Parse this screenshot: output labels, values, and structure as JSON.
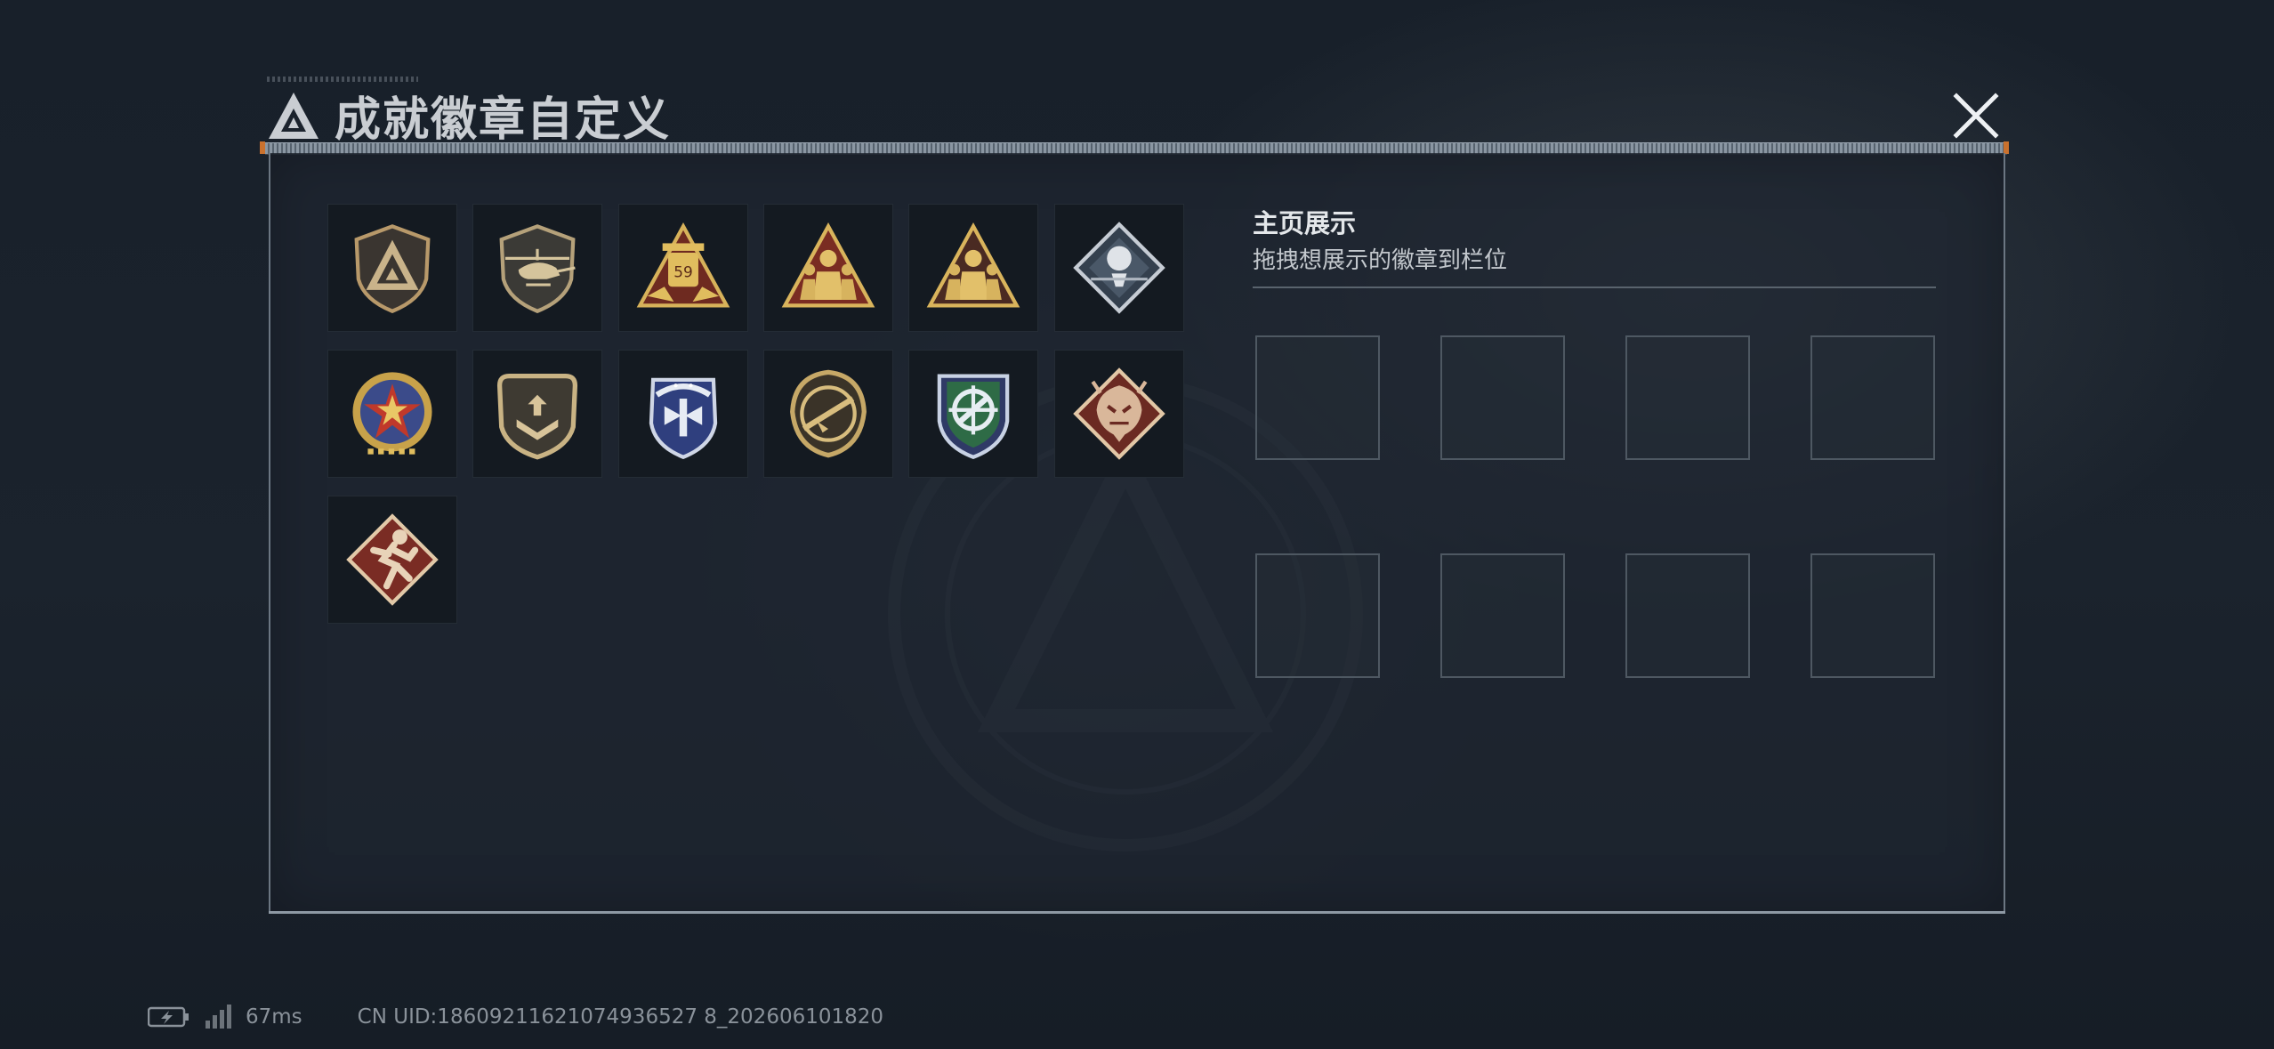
{
  "window": {
    "title": "成就徽章自定义",
    "close_label": "close"
  },
  "badges": [
    {
      "name": "emblem-shield-badge",
      "shape": "shield",
      "theme": "bronze"
    },
    {
      "name": "helicopter-badge",
      "shape": "shield",
      "theme": "bronze"
    },
    {
      "name": "gold-59-badge",
      "shape": "triangle",
      "theme": "gold",
      "label": "59"
    },
    {
      "name": "team-red-triangle-badge",
      "shape": "triangle",
      "theme": "gold"
    },
    {
      "name": "team-dark-triangle-badge",
      "shape": "triangle",
      "theme": "gold"
    },
    {
      "name": "rose-diamond-badge",
      "shape": "diamond",
      "theme": "silver"
    },
    {
      "name": "star-medal-badge",
      "shape": "round",
      "theme": "gold-red"
    },
    {
      "name": "chevron-shield-badge",
      "shape": "shield",
      "theme": "bronze"
    },
    {
      "name": "wings-blue-shield-badge",
      "shape": "shield",
      "theme": "blue"
    },
    {
      "name": "rifle-round-badge",
      "shape": "round",
      "theme": "bronze"
    },
    {
      "name": "crosshair-green-shield-badge",
      "shape": "shield",
      "theme": "green"
    },
    {
      "name": "dragon-diamond-badge",
      "shape": "diamond",
      "theme": "red"
    },
    {
      "name": "runner-diamond-badge",
      "shape": "diamond",
      "theme": "red"
    }
  ],
  "showcase": {
    "title": "主页展示",
    "subtitle": "拖拽想展示的徽章到栏位",
    "slot_count": 8
  },
  "status_bar": {
    "ping": "67ms",
    "uid": "CN UID:18609211621074936527 8_202606101820"
  },
  "colors": {
    "accent_orange": "#c9712e",
    "panel_border": "#6b7682",
    "title_text": "#c9cdd2"
  }
}
